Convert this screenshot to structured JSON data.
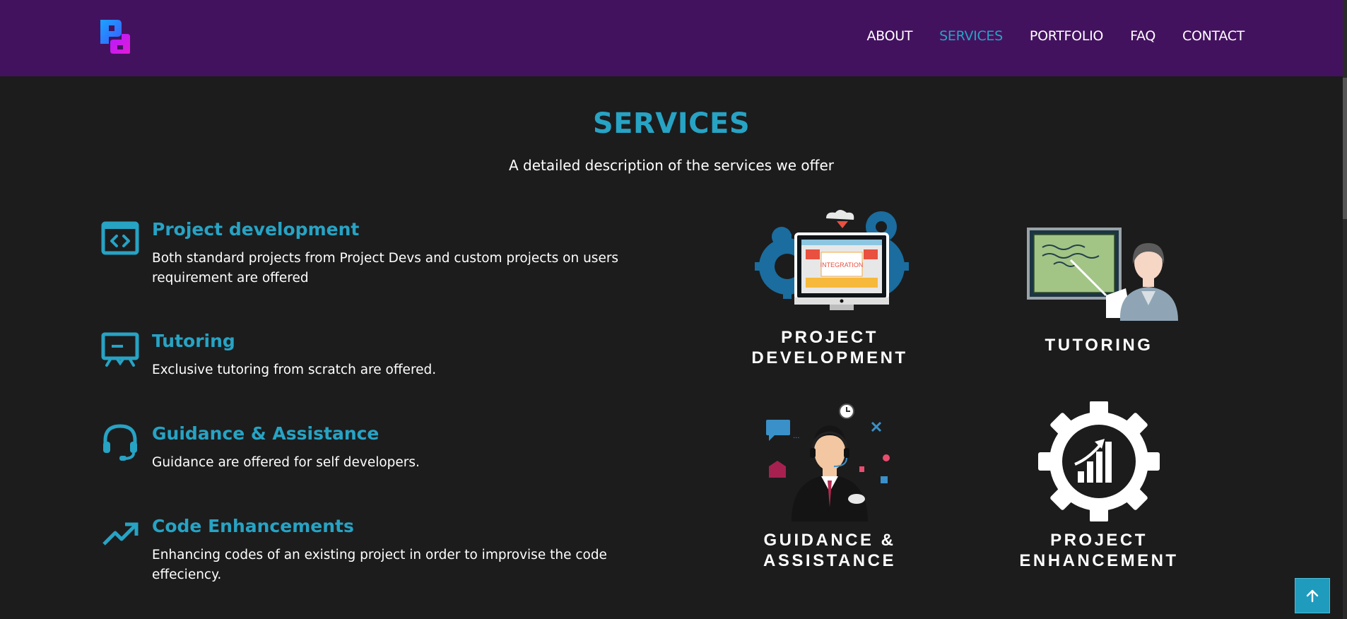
{
  "header": {
    "logo_alt": "PD",
    "nav": [
      {
        "label": "ABOUT"
      },
      {
        "label": "SERVICES",
        "active": true
      },
      {
        "label": "PORTFOLIO"
      },
      {
        "label": "FAQ"
      },
      {
        "label": "CONTACT"
      }
    ]
  },
  "section": {
    "title": "SERVICES",
    "subtitle": "A detailed description of the services we offer"
  },
  "services": [
    {
      "icon": "code-icon",
      "title": "Project development",
      "desc": "Both standard projects from Project Devs and custom projects on users requirement are offered"
    },
    {
      "icon": "presentation-board-icon",
      "title": "Tutoring",
      "desc": "Exclusive tutoring from scratch are offered."
    },
    {
      "icon": "headset-icon",
      "title": "Guidance & Assistance",
      "desc": "Guidance are offered for self developers."
    },
    {
      "icon": "trending-up-icon",
      "title": "Code Enhancements",
      "desc": "Enhancing codes of an existing project in order to improvise the code effeciency."
    }
  ],
  "cards": [
    {
      "label": "PROJECT DEVELOPMENT",
      "image_text": "INTEGRATION"
    },
    {
      "label": "TUTORING"
    },
    {
      "label": "GUIDANCE & ASSISTANCE"
    },
    {
      "label": "PROJECT ENHANCEMENT"
    }
  ],
  "colors": {
    "header_bg": "#43125f",
    "page_bg": "#1c1c1d",
    "accent": "#27a3c4"
  },
  "scroll_top_icon": "arrow-up-icon"
}
